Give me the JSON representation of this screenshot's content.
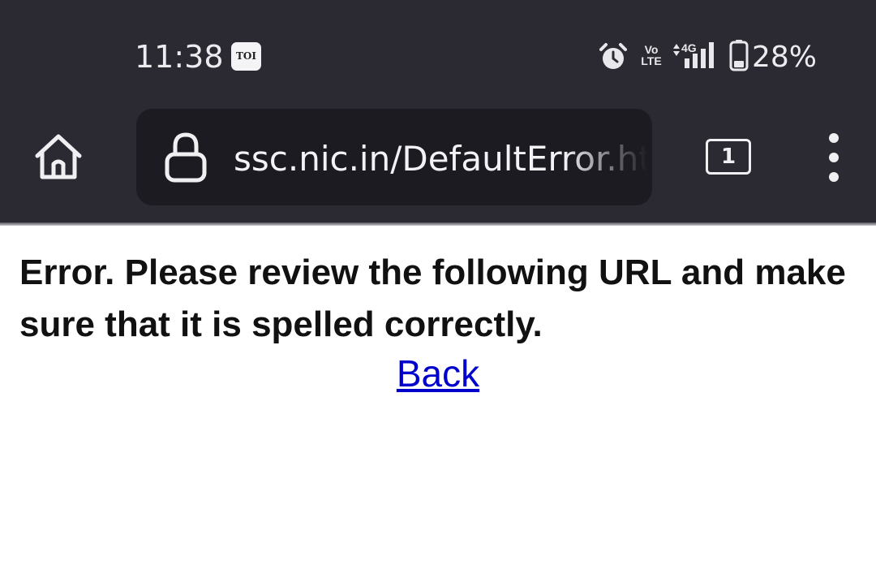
{
  "status_bar": {
    "time": "11:38",
    "notification_badge": "TOI",
    "network_label_top": "Vo",
    "network_label_bottom": "LTE",
    "network_type": "4G",
    "battery_percent": "28%",
    "icons": [
      "alarm-icon",
      "signal-icon",
      "battery-icon"
    ]
  },
  "toolbar": {
    "url": "ssc.nic.in/DefaultError.html",
    "tab_count": "1",
    "icons": [
      "home-icon",
      "lock-icon",
      "tabs-icon",
      "overflow-menu-icon"
    ]
  },
  "page": {
    "error_message": "Error. Please review the following URL and make sure that it is spelled correctly.",
    "back_link": "Back",
    "link_color": "#0000cc"
  },
  "colors": {
    "toolbar_bg": "#2b2a33",
    "url_bar_bg": "#1c1b22"
  }
}
